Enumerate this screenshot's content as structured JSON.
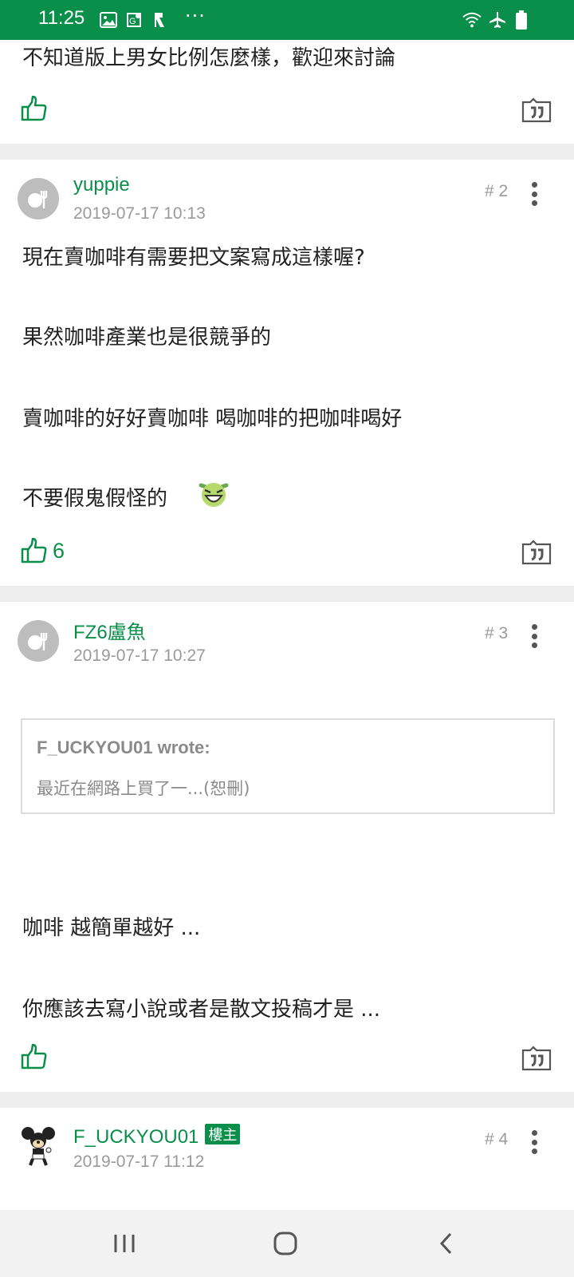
{
  "status_bar": {
    "time": "11:25",
    "icons_left": [
      "gallery-icon",
      "maps-icon",
      "app-icon"
    ],
    "more": "···",
    "icons_right": [
      "wifi-icon",
      "airplane-icon",
      "battery-icon"
    ]
  },
  "posts": [
    {
      "text_lines": [
        "不知道版上男女比例怎麼樣，歡迎來討論"
      ],
      "likes": ""
    },
    {
      "author": "yuppie",
      "time": "2019-07-17 10:13",
      "floor": "# 2",
      "text_lines": [
        "現在賣咖啡有需要把文案寫成這樣喔?",
        "果然咖啡產業也是很競爭的",
        "賣咖啡的好好賣咖啡 喝咖啡的把咖啡喝好",
        "不要假鬼假怪的"
      ],
      "emoji": "laughing-emoji",
      "likes": "6"
    },
    {
      "author": "FZ6盧魚",
      "time": "2019-07-17 10:27",
      "floor": "# 3",
      "quote_author": "F_UCKYOU01 wrote:",
      "quote_text": "最近在網路上買了一...(恕刪)",
      "text_lines": [
        "咖啡 越簡單越好 ...",
        "你應該去寫小說或者是散文投稿才是 ..."
      ],
      "likes": ""
    },
    {
      "author": "F_UCKYOU01",
      "badge": "樓主",
      "time": "2019-07-17 11:12",
      "floor": "# 4"
    }
  ],
  "colors": {
    "accent": "#0a8f4a",
    "muted": "#9a9a9a",
    "separator": "#eeeeee"
  }
}
